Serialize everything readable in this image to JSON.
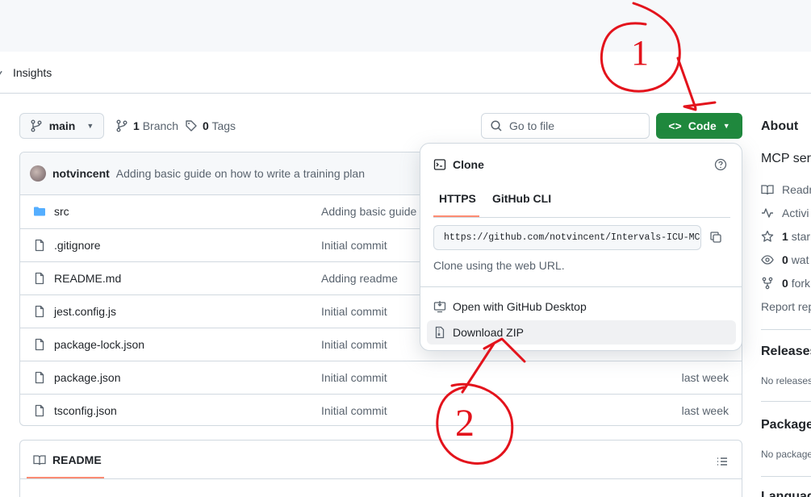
{
  "nav": {
    "insights_label": "Insights"
  },
  "toolbar": {
    "branch_name": "main",
    "branches_count": "1",
    "branches_label": "Branch",
    "tags_count": "0",
    "tags_label": "Tags",
    "goto_placeholder": "Go to file",
    "code_label": "Code"
  },
  "commit": {
    "author": "notvincent",
    "message": "Adding basic guide on how to write a training plan"
  },
  "files": [
    {
      "name": "src",
      "type": "folder",
      "message": "Adding basic guide",
      "time": ""
    },
    {
      "name": ".gitignore",
      "type": "file",
      "message": "Initial commit",
      "time": ""
    },
    {
      "name": "README.md",
      "type": "file",
      "message": "Adding readme",
      "time": ""
    },
    {
      "name": "jest.config.js",
      "type": "file",
      "message": "Initial commit",
      "time": ""
    },
    {
      "name": "package-lock.json",
      "type": "file",
      "message": "Initial commit",
      "time": ""
    },
    {
      "name": "package.json",
      "type": "file",
      "message": "Initial commit",
      "time": "last week"
    },
    {
      "name": "tsconfig.json",
      "type": "file",
      "message": "Initial commit",
      "time": "last week"
    }
  ],
  "readme": {
    "tab_label": "README"
  },
  "clone_menu": {
    "title": "Clone",
    "tabs": [
      "HTTPS",
      "GitHub CLI"
    ],
    "url": "https://github.com/notvincent/Intervals-ICU-MCP",
    "hint": "Clone using the web URL.",
    "open_desktop": "Open with GitHub Desktop",
    "download_zip": "Download ZIP"
  },
  "sidebar": {
    "about_title": "About",
    "description": "MCP serv",
    "items": [
      {
        "icon": "book-icon",
        "count": "",
        "label": "Readm"
      },
      {
        "icon": "pulse-icon",
        "count": "",
        "label": "Activi"
      },
      {
        "icon": "star-icon",
        "count": "1",
        "label": "star"
      },
      {
        "icon": "eye-icon",
        "count": "0",
        "label": "wat"
      },
      {
        "icon": "fork-icon",
        "count": "0",
        "label": "fork"
      }
    ],
    "report_label": "Report rep",
    "releases_title": "Releases",
    "releases_note": "No releases",
    "packages_title": "Packages",
    "packages_note": "No package",
    "languages_title": "Language"
  },
  "annotations": {
    "first": "1",
    "second": "2"
  },
  "colors": {
    "accent_green": "#1f883d",
    "tab_underline": "#fd8c73",
    "annotation_red": "#e3131c"
  }
}
